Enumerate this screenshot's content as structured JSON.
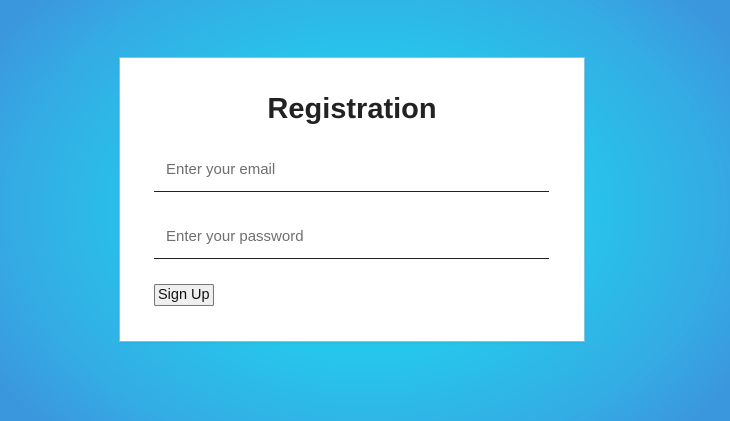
{
  "form": {
    "title": "Registration",
    "email": {
      "value": "",
      "placeholder": "Enter your email"
    },
    "password": {
      "value": "",
      "placeholder": "Enter your password"
    },
    "submit_label": "Sign Up"
  },
  "colors": {
    "background_center": "#23cdf0",
    "background_edge": "#3b97dd",
    "card": "#ffffff",
    "text": "#222222",
    "placeholder": "#6f6f6f"
  }
}
